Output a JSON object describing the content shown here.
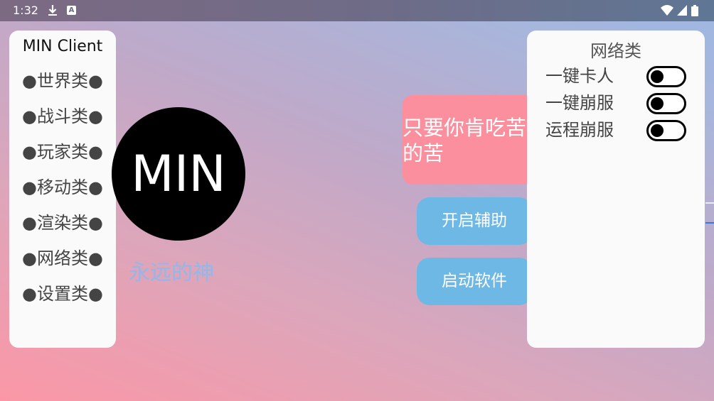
{
  "status_bar": {
    "time": "1:32",
    "icons": [
      "download-icon",
      "a-icon",
      "wifi-icon",
      "signal-icon",
      "battery-icon"
    ],
    "a_glyph": "A"
  },
  "left_panel": {
    "title": "MIN Client",
    "items": [
      {
        "label": "●世界类●"
      },
      {
        "label": "●战斗类●"
      },
      {
        "label": "●玩家类●"
      },
      {
        "label": "●移动类●"
      },
      {
        "label": "●渲染类●"
      },
      {
        "label": "●网络类●"
      },
      {
        "label": "●设置类●"
      }
    ]
  },
  "logo": {
    "text": "MIN",
    "tagline": "永远的神"
  },
  "slogan": {
    "text": "只要你肯吃苦的苦"
  },
  "buttons": {
    "open_assist": "开启辅助",
    "start_app": "启动软件"
  },
  "right_panel": {
    "title": "网络类",
    "toggles": [
      {
        "label": "一键卡人",
        "on": false
      },
      {
        "label": "一键崩服",
        "on": false
      },
      {
        "label": "运程崩服",
        "on": false
      }
    ]
  },
  "colors": {
    "slogan_bg": "#fb8f9e",
    "button_bg": "#6db8e4",
    "tagline": "#90b8ea",
    "panel_bg": "#fafafa"
  }
}
